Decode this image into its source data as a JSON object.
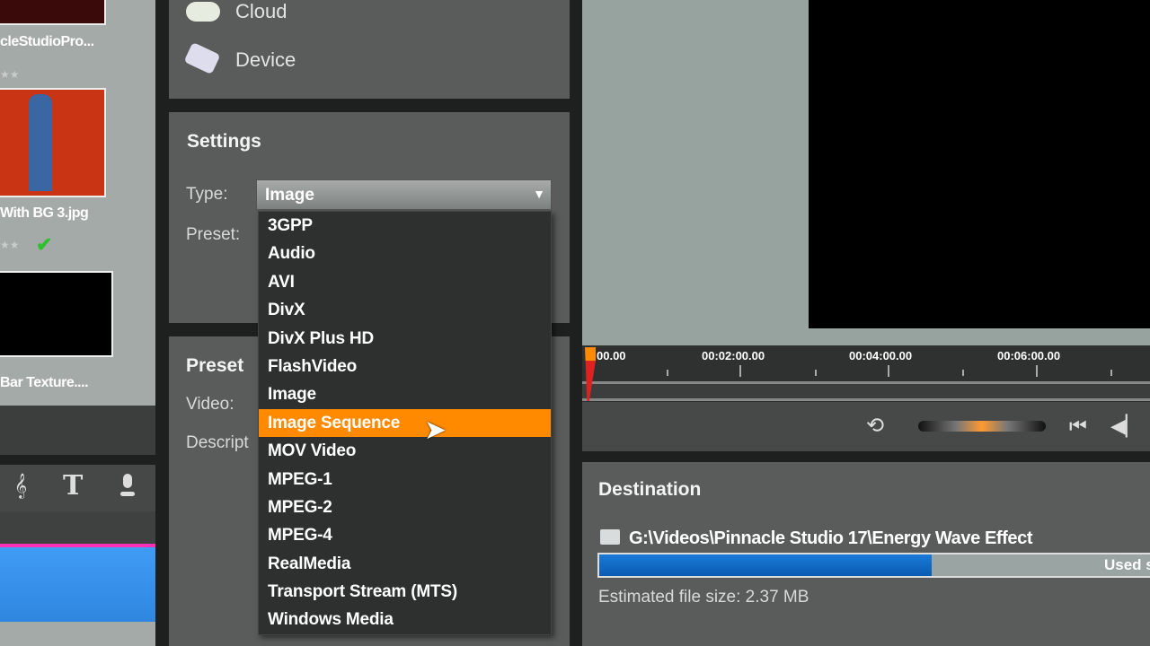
{
  "library": {
    "items": [
      {
        "caption": "cleStudioPro..."
      },
      {
        "caption": "With BG 3.jpg",
        "rating_stars": "★★",
        "checked": true
      },
      {
        "caption": "Bar Texture...."
      }
    ]
  },
  "toolbar_icons": [
    "music-note-icon",
    "title-text-icon",
    "microphone-icon"
  ],
  "output": {
    "cloud": "Cloud",
    "device": "Device"
  },
  "settings": {
    "title": "Settings",
    "type_label": "Type:",
    "type_value": "Image",
    "preset_label": "Preset:",
    "options": [
      "3GPP",
      "Audio",
      "AVI",
      "DivX",
      "DivX Plus HD",
      "FlashVideo",
      "Image",
      "Image Sequence",
      "MOV Video",
      "MPEG-1",
      "MPEG-2",
      "MPEG-4",
      "RealMedia",
      "Transport Stream (MTS)",
      "Windows Media"
    ],
    "highlighted": "Image Sequence"
  },
  "preset_details": {
    "title": "Preset",
    "video_label": "Video:",
    "description_label": "Descript"
  },
  "timeline": {
    "ticks": [
      "00.00",
      "00:02:00.00",
      "00:04:00.00",
      "00:06:00.00"
    ]
  },
  "destination": {
    "title": "Destination",
    "path": "G:\\Videos\\Pinnacle Studio 17\\Energy Wave Effect",
    "used_label": "Used s",
    "used_fraction": 0.6,
    "estimate": "Estimated file size: 2.37 MB"
  },
  "colors": {
    "accent": "#ff8a00",
    "progress": "#0b68c4",
    "clip": "#3d97ef"
  }
}
